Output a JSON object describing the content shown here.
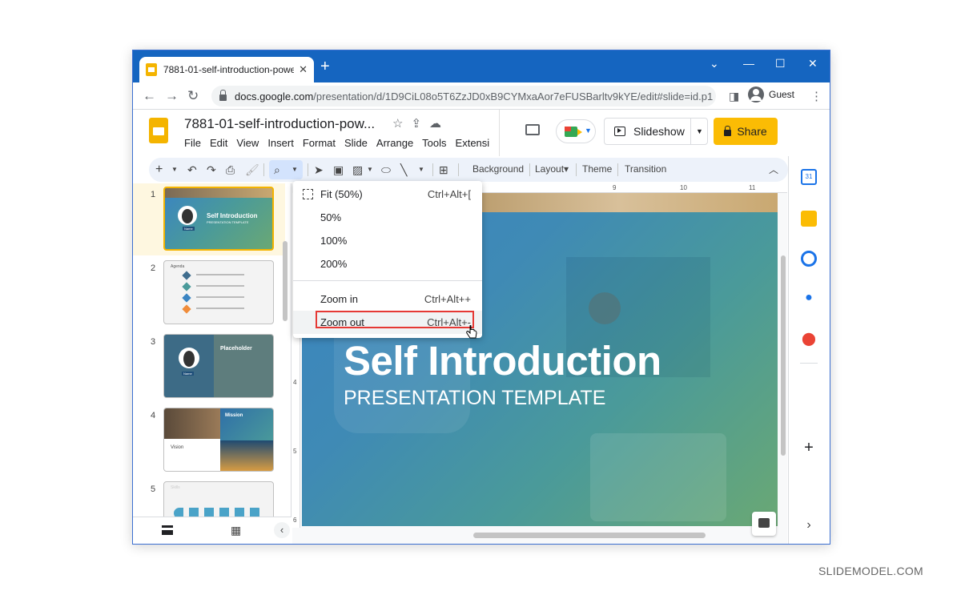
{
  "browser": {
    "tab_title": "7881-01-self-introduction-power",
    "tab_close": "✕",
    "new_tab": "+",
    "url_host": "docs.google.com",
    "url_path": "/presentation/d/1D9CiL08o5T6ZzJD0xB9CYMxaAor7eFUSBarltv9kYE/edit#slide=id.p1",
    "guest_label": "Guest",
    "window_controls": [
      "⌄",
      "—",
      "☐",
      "✕"
    ]
  },
  "doc": {
    "title": "7881-01-self-introduction-pow...",
    "menu": [
      "File",
      "Edit",
      "View",
      "Insert",
      "Format",
      "Slide",
      "Arrange",
      "Tools",
      "Extensi"
    ],
    "slideshow_label": "Slideshow",
    "share_label": "Share"
  },
  "toolbar": {
    "background_label": "Background",
    "layout_label": "Layout▾",
    "theme_label": "Theme",
    "transition_label": "Transition"
  },
  "ruler": {
    "ticks": [
      "9",
      "10",
      "11"
    ],
    "left_ticks": [
      "4",
      "5",
      "6"
    ]
  },
  "zoom_menu": {
    "items": [
      {
        "label": "Fit (50%)",
        "shortcut": "Ctrl+Alt+["
      },
      {
        "label": "50%",
        "shortcut": ""
      },
      {
        "label": "100%",
        "shortcut": ""
      },
      {
        "label": "200%",
        "shortcut": ""
      },
      {
        "label": "Zoom in",
        "shortcut": "Ctrl+Alt++"
      },
      {
        "label": "Zoom out",
        "shortcut": "Ctrl+Alt+-"
      }
    ],
    "highlighted": "Zoom out"
  },
  "filmstrip": {
    "slide_numbers": [
      "1",
      "2",
      "3",
      "4",
      "5"
    ],
    "thumb1_title": "Self Introduction",
    "thumb1_sub": "PRESENTATION TEMPLATE",
    "thumb1_name": "Name",
    "thumb2_title": "Agenda",
    "thumb3_title": "Placeholder",
    "thumb3_name": "Name",
    "thumb4_title": "Mission",
    "thumb4_sub": "Vision",
    "thumb5_title": "Skills"
  },
  "slide": {
    "title": "Self Introduction",
    "subtitle": "PRESENTATION TEMPLATE"
  },
  "watermark": "SLIDEMODEL.COM",
  "colors": {
    "chrome_blue": "#1565c0",
    "share_yellow": "#fbbc04",
    "highlight_red": "#e53935",
    "selected_slide_bg": "#fef7e0"
  },
  "icons": {
    "right_panel": [
      "calendar-icon",
      "keep-icon",
      "tasks-icon",
      "contacts-icon",
      "maps-icon",
      "add-icon",
      "expand-icon"
    ]
  }
}
